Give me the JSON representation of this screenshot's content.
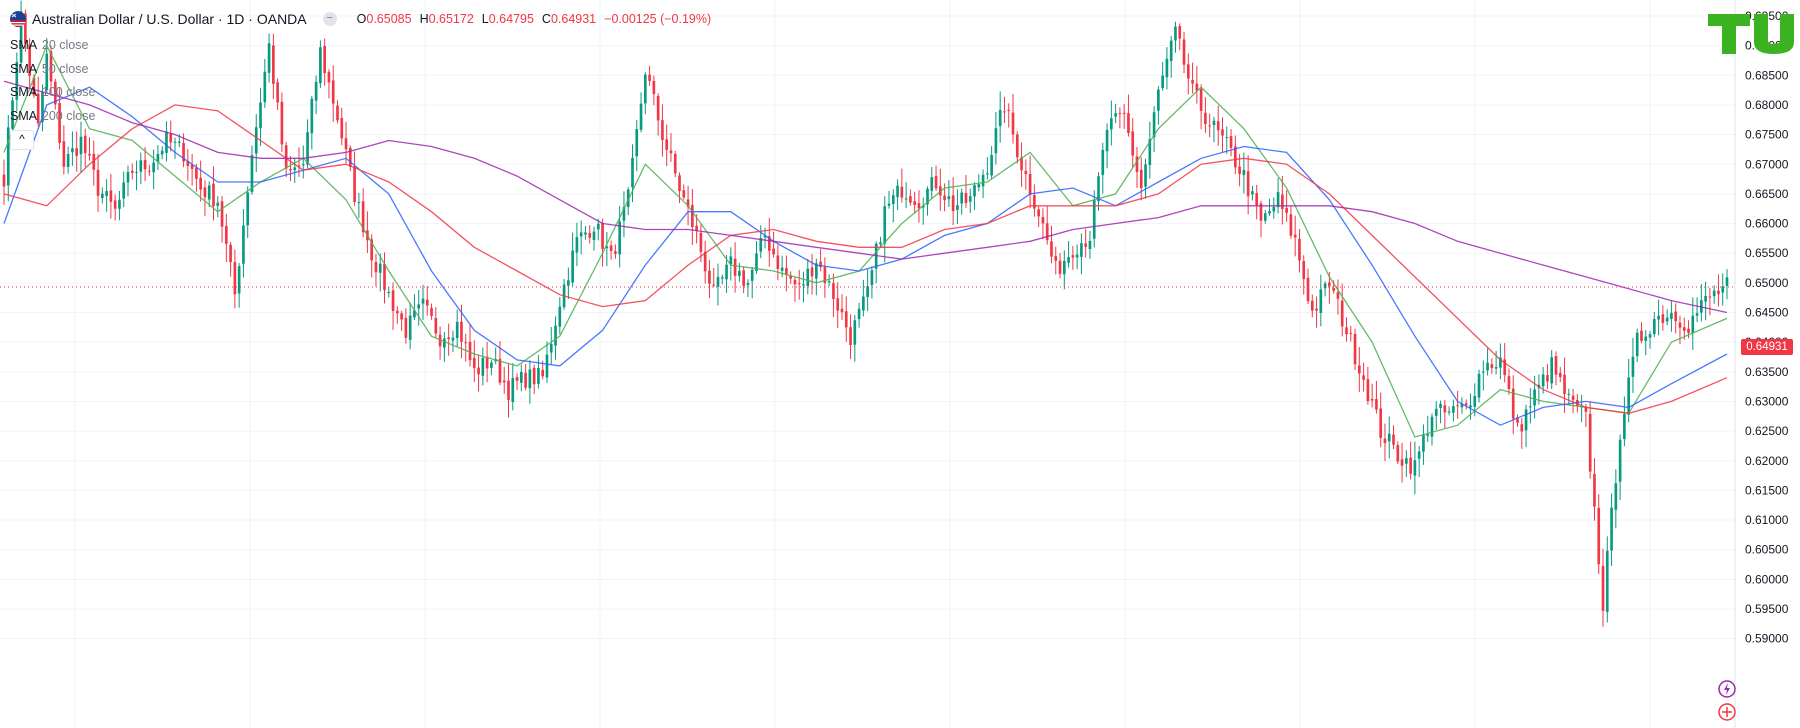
{
  "header": {
    "title": "Australian Dollar / U.S. Dollar · 1D · OANDA",
    "collapse_glyph": "−",
    "ohlc": {
      "o_label": "O",
      "o_value": "0.65085",
      "h_label": "H",
      "h_value": "0.65172",
      "l_label": "L",
      "l_value": "0.64795",
      "c_label": "C",
      "c_value": "0.64931",
      "change": "−0.00125 (−0.19%)"
    }
  },
  "indicators": [
    {
      "name": "SMA",
      "param": "20 close",
      "color": "#4caf50"
    },
    {
      "name": "SMA",
      "param": "50 close",
      "color": "#2962ff"
    },
    {
      "name": "SMA",
      "param": "100 close",
      "color": "#f23645"
    },
    {
      "name": "SMA",
      "param": "200 close",
      "color": "#9c27b0"
    }
  ],
  "legend_toggle_glyph": "^",
  "logo": {
    "text": "TU",
    "color": "#3bb321"
  },
  "price_badge": "0.64931",
  "icons": [
    "lightning-icon",
    "fx-icon",
    "flag-icon"
  ],
  "colors": {
    "up": "#089981",
    "down": "#f23645",
    "current_price_line": "#f23645",
    "grid": "#f0f3fa",
    "axis_text": "#131722"
  },
  "chart_data": {
    "type": "candlestick",
    "symbol": "AUDUSD",
    "timeframe": "1D",
    "y_ticks": [
      "0.69500",
      "0.69000",
      "0.68500",
      "0.68000",
      "0.67500",
      "0.67000",
      "0.66500",
      "0.66000",
      "0.65500",
      "0.65000",
      "0.64500",
      "0.64000",
      "0.63500",
      "0.63000",
      "0.62500",
      "0.62000",
      "0.61500",
      "0.61000",
      "0.60500",
      "0.60000",
      "0.59500",
      "0.59000"
    ],
    "ylim": [
      0.5875,
      0.6975
    ],
    "current_price": 0.64931,
    "close_path": [
      [
        0,
        0.668
      ],
      [
        4,
        0.695
      ],
      [
        8,
        0.676
      ],
      [
        10,
        0.688
      ],
      [
        14,
        0.67
      ],
      [
        18,
        0.674
      ],
      [
        22,
        0.666
      ],
      [
        26,
        0.662
      ],
      [
        30,
        0.669
      ],
      [
        34,
        0.67
      ],
      [
        38,
        0.674
      ],
      [
        42,
        0.672
      ],
      [
        46,
        0.666
      ],
      [
        50,
        0.664
      ],
      [
        54,
        0.648
      ],
      [
        58,
        0.672
      ],
      [
        62,
        0.69
      ],
      [
        66,
        0.668
      ],
      [
        70,
        0.67
      ],
      [
        74,
        0.689
      ],
      [
        78,
        0.678
      ],
      [
        82,
        0.665
      ],
      [
        86,
        0.655
      ],
      [
        90,
        0.648
      ],
      [
        94,
        0.642
      ],
      [
        98,
        0.646
      ],
      [
        102,
        0.641
      ],
      [
        106,
        0.643
      ],
      [
        110,
        0.635
      ],
      [
        114,
        0.637
      ],
      [
        118,
        0.632
      ],
      [
        122,
        0.634
      ],
      [
        126,
        0.634
      ],
      [
        130,
        0.647
      ],
      [
        134,
        0.657
      ],
      [
        138,
        0.66
      ],
      [
        142,
        0.654
      ],
      [
        146,
        0.664
      ],
      [
        150,
        0.686
      ],
      [
        154,
        0.675
      ],
      [
        158,
        0.666
      ],
      [
        162,
        0.658
      ],
      [
        166,
        0.648
      ],
      [
        170,
        0.653
      ],
      [
        174,
        0.65
      ],
      [
        178,
        0.658
      ],
      [
        182,
        0.652
      ],
      [
        186,
        0.649
      ],
      [
        190,
        0.654
      ],
      [
        194,
        0.648
      ],
      [
        198,
        0.641
      ],
      [
        202,
        0.648
      ],
      [
        206,
        0.662
      ],
      [
        210,
        0.666
      ],
      [
        214,
        0.664
      ],
      [
        218,
        0.667
      ],
      [
        222,
        0.663
      ],
      [
        226,
        0.664
      ],
      [
        230,
        0.67
      ],
      [
        234,
        0.68
      ],
      [
        238,
        0.67
      ],
      [
        242,
        0.662
      ],
      [
        246,
        0.652
      ],
      [
        250,
        0.656
      ],
      [
        254,
        0.658
      ],
      [
        258,
        0.676
      ],
      [
        262,
        0.678
      ],
      [
        266,
        0.666
      ],
      [
        270,
        0.682
      ],
      [
        274,
        0.692
      ],
      [
        278,
        0.682
      ],
      [
        282,
        0.677
      ],
      [
        286,
        0.673
      ],
      [
        290,
        0.668
      ],
      [
        294,
        0.66
      ],
      [
        298,
        0.664
      ],
      [
        302,
        0.657
      ],
      [
        306,
        0.645
      ],
      [
        310,
        0.65
      ],
      [
        314,
        0.642
      ],
      [
        318,
        0.634
      ],
      [
        322,
        0.625
      ],
      [
        326,
        0.621
      ],
      [
        330,
        0.619
      ],
      [
        334,
        0.628
      ],
      [
        338,
        0.628
      ],
      [
        342,
        0.629
      ],
      [
        346,
        0.636
      ],
      [
        350,
        0.637
      ],
      [
        354,
        0.625
      ],
      [
        358,
        0.631
      ],
      [
        362,
        0.636
      ],
      [
        366,
        0.63
      ],
      [
        370,
        0.627
      ],
      [
        374,
        0.596
      ],
      [
        378,
        0.625
      ],
      [
        382,
        0.64
      ],
      [
        386,
        0.644
      ],
      [
        390,
        0.645
      ],
      [
        394,
        0.643
      ],
      [
        398,
        0.647
      ],
      [
        402,
        0.649
      ],
      [
        403,
        0.6493
      ]
    ],
    "sma_20": [
      [
        0,
        0.672
      ],
      [
        10,
        0.69
      ],
      [
        20,
        0.676
      ],
      [
        30,
        0.674
      ],
      [
        40,
        0.668
      ],
      [
        50,
        0.662
      ],
      [
        60,
        0.667
      ],
      [
        70,
        0.671
      ],
      [
        80,
        0.664
      ],
      [
        90,
        0.652
      ],
      [
        100,
        0.641
      ],
      [
        110,
        0.638
      ],
      [
        120,
        0.636
      ],
      [
        130,
        0.641
      ],
      [
        140,
        0.655
      ],
      [
        150,
        0.67
      ],
      [
        160,
        0.663
      ],
      [
        170,
        0.653
      ],
      [
        180,
        0.652
      ],
      [
        190,
        0.65
      ],
      [
        200,
        0.652
      ],
      [
        210,
        0.66
      ],
      [
        220,
        0.666
      ],
      [
        230,
        0.667
      ],
      [
        240,
        0.672
      ],
      [
        250,
        0.663
      ],
      [
        260,
        0.665
      ],
      [
        270,
        0.676
      ],
      [
        280,
        0.683
      ],
      [
        290,
        0.676
      ],
      [
        300,
        0.666
      ],
      [
        310,
        0.651
      ],
      [
        320,
        0.64
      ],
      [
        330,
        0.624
      ],
      [
        340,
        0.626
      ],
      [
        350,
        0.632
      ],
      [
        360,
        0.63
      ],
      [
        370,
        0.629
      ],
      [
        380,
        0.628
      ],
      [
        390,
        0.64
      ],
      [
        403,
        0.644
      ]
    ],
    "sma_50": [
      [
        0,
        0.66
      ],
      [
        10,
        0.68
      ],
      [
        20,
        0.683
      ],
      [
        30,
        0.678
      ],
      [
        40,
        0.672
      ],
      [
        50,
        0.667
      ],
      [
        60,
        0.667
      ],
      [
        70,
        0.669
      ],
      [
        80,
        0.671
      ],
      [
        90,
        0.665
      ],
      [
        100,
        0.652
      ],
      [
        110,
        0.642
      ],
      [
        120,
        0.637
      ],
      [
        130,
        0.636
      ],
      [
        140,
        0.642
      ],
      [
        150,
        0.653
      ],
      [
        160,
        0.662
      ],
      [
        170,
        0.662
      ],
      [
        180,
        0.657
      ],
      [
        190,
        0.653
      ],
      [
        200,
        0.652
      ],
      [
        210,
        0.654
      ],
      [
        220,
        0.658
      ],
      [
        230,
        0.66
      ],
      [
        240,
        0.665
      ],
      [
        250,
        0.666
      ],
      [
        260,
        0.663
      ],
      [
        270,
        0.667
      ],
      [
        280,
        0.671
      ],
      [
        290,
        0.673
      ],
      [
        300,
        0.672
      ],
      [
        310,
        0.664
      ],
      [
        320,
        0.653
      ],
      [
        330,
        0.641
      ],
      [
        340,
        0.63
      ],
      [
        350,
        0.626
      ],
      [
        360,
        0.629
      ],
      [
        370,
        0.63
      ],
      [
        380,
        0.629
      ],
      [
        390,
        0.633
      ],
      [
        403,
        0.638
      ]
    ],
    "sma_100": [
      [
        0,
        0.665
      ],
      [
        10,
        0.663
      ],
      [
        20,
        0.67
      ],
      [
        30,
        0.676
      ],
      [
        40,
        0.68
      ],
      [
        50,
        0.679
      ],
      [
        60,
        0.674
      ],
      [
        70,
        0.669
      ],
      [
        80,
        0.67
      ],
      [
        90,
        0.667
      ],
      [
        100,
        0.662
      ],
      [
        110,
        0.656
      ],
      [
        120,
        0.652
      ],
      [
        130,
        0.648
      ],
      [
        140,
        0.646
      ],
      [
        150,
        0.647
      ],
      [
        160,
        0.653
      ],
      [
        170,
        0.658
      ],
      [
        180,
        0.659
      ],
      [
        190,
        0.657
      ],
      [
        200,
        0.656
      ],
      [
        210,
        0.656
      ],
      [
        220,
        0.659
      ],
      [
        230,
        0.66
      ],
      [
        240,
        0.663
      ],
      [
        250,
        0.663
      ],
      [
        260,
        0.663
      ],
      [
        270,
        0.665
      ],
      [
        280,
        0.67
      ],
      [
        290,
        0.671
      ],
      [
        300,
        0.67
      ],
      [
        310,
        0.665
      ],
      [
        320,
        0.658
      ],
      [
        330,
        0.651
      ],
      [
        340,
        0.644
      ],
      [
        350,
        0.637
      ],
      [
        360,
        0.632
      ],
      [
        370,
        0.629
      ],
      [
        380,
        0.628
      ],
      [
        390,
        0.63
      ],
      [
        403,
        0.634
      ]
    ],
    "sma_200": [
      [
        0,
        0.684
      ],
      [
        10,
        0.682
      ],
      [
        20,
        0.68
      ],
      [
        30,
        0.677
      ],
      [
        40,
        0.675
      ],
      [
        50,
        0.672
      ],
      [
        60,
        0.671
      ],
      [
        70,
        0.671
      ],
      [
        80,
        0.672
      ],
      [
        90,
        0.674
      ],
      [
        100,
        0.673
      ],
      [
        110,
        0.671
      ],
      [
        120,
        0.668
      ],
      [
        130,
        0.664
      ],
      [
        140,
        0.66
      ],
      [
        150,
        0.659
      ],
      [
        160,
        0.659
      ],
      [
        170,
        0.658
      ],
      [
        180,
        0.657
      ],
      [
        190,
        0.656
      ],
      [
        200,
        0.655
      ],
      [
        210,
        0.654
      ],
      [
        220,
        0.655
      ],
      [
        230,
        0.656
      ],
      [
        240,
        0.657
      ],
      [
        250,
        0.659
      ],
      [
        260,
        0.66
      ],
      [
        270,
        0.661
      ],
      [
        280,
        0.663
      ],
      [
        290,
        0.663
      ],
      [
        300,
        0.663
      ],
      [
        310,
        0.663
      ],
      [
        320,
        0.662
      ],
      [
        330,
        0.66
      ],
      [
        340,
        0.657
      ],
      [
        350,
        0.655
      ],
      [
        360,
        0.653
      ],
      [
        370,
        0.651
      ],
      [
        380,
        0.649
      ],
      [
        390,
        0.647
      ],
      [
        403,
        0.645
      ]
    ]
  }
}
